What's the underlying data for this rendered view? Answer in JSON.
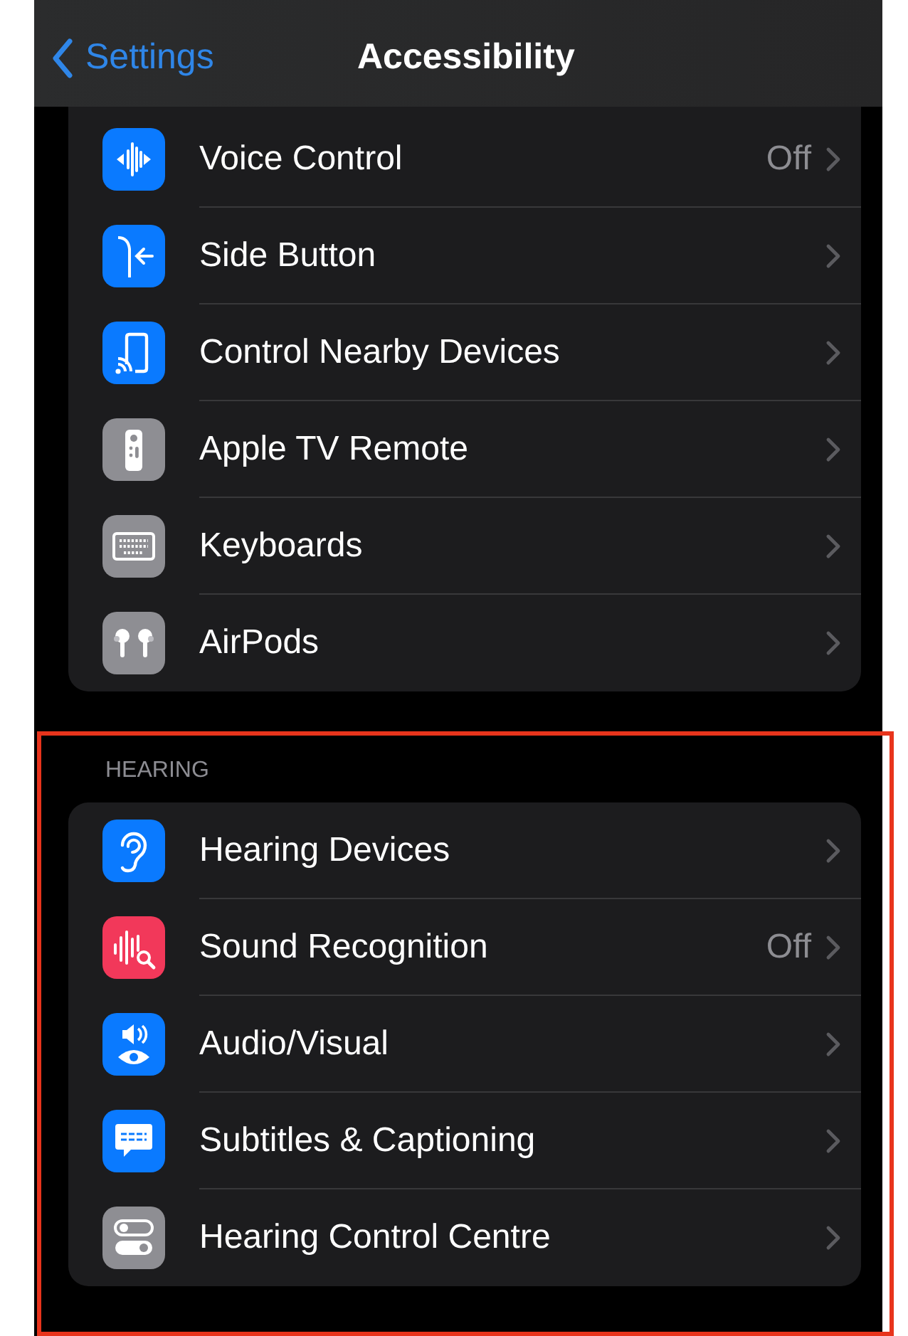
{
  "nav": {
    "back": "Settings",
    "title": "Accessibility"
  },
  "sections": [
    {
      "highlighted": false,
      "rows": [
        {
          "kind": "waveform",
          "color": "#0a7aff",
          "label": "Voice Control",
          "value": "Off"
        },
        {
          "kind": "sidebutton",
          "color": "#0a7aff",
          "label": "Side Button"
        },
        {
          "kind": "cast",
          "color": "#0a7aff",
          "label": "Control Nearby Devices"
        },
        {
          "kind": "remote",
          "color": "#8e8e93",
          "label": "Apple TV Remote"
        },
        {
          "kind": "keyboard",
          "color": "#8e8e93",
          "label": "Keyboards"
        },
        {
          "kind": "earbuds",
          "color": "#8e8e93",
          "label": "AirPods"
        }
      ]
    },
    {
      "header": "HEARING",
      "highlighted": true,
      "rows": [
        {
          "kind": "ear",
          "color": "#0a7aff",
          "label": "Hearing Devices"
        },
        {
          "kind": "soundsearch",
          "color": "#f2385a",
          "label": "Sound Recognition",
          "value": "Off"
        },
        {
          "kind": "speakereye",
          "color": "#0a7aff",
          "label": "Audio/Visual"
        },
        {
          "kind": "bubble",
          "color": "#0a7aff",
          "label": "Subtitles & Captioning"
        },
        {
          "kind": "toggles",
          "color": "#8e8e93",
          "label": "Hearing Control Centre"
        }
      ]
    }
  ]
}
